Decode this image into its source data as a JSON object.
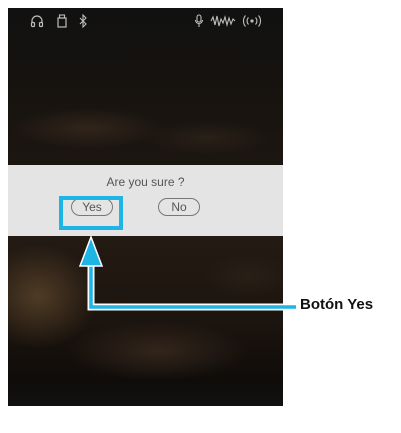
{
  "status_bar": {
    "icons": [
      "headphones-icon",
      "usb-icon",
      "bluetooth-icon",
      "microphone-icon",
      "waveform-icon",
      "wireless-icon"
    ]
  },
  "dialog": {
    "message": "Are you sure ?",
    "yes_label": "Yes",
    "no_label": "No"
  },
  "annotation": {
    "label": "Botón Yes",
    "color": "#1eb4e6"
  }
}
